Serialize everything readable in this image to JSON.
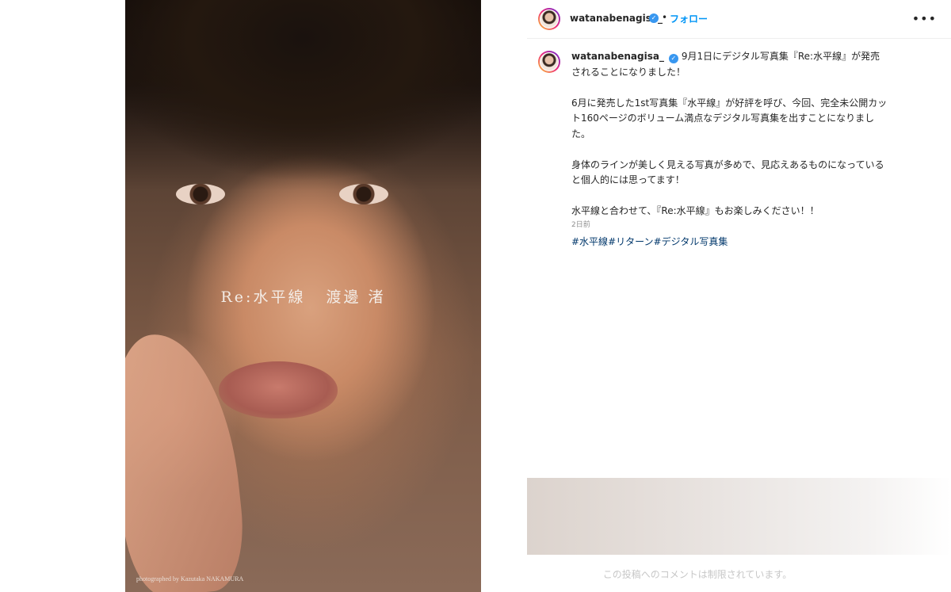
{
  "post": {
    "cover_title_main": "Re:水平線",
    "cover_title_name": "渡邊 渚",
    "cover_credit": "photographed by Kazutaka NAKAMURA"
  },
  "header": {
    "username": "watanabenagisa_",
    "separator": "•",
    "follow_label": "フォロー",
    "more_icon": "more-horizontal-icon"
  },
  "caption": {
    "username": "watanabenagisa_",
    "lead": "9月1日にデジタル写真集『Re:水平線』が発売されることになりました！",
    "paragraphs": [
      "6月に発売した1st写真集『水平線』が好評を呼び、今回、完全未公開カット160ページのボリューム満点なデジタル写真集を出すことになりました。",
      "身体のラインが美しく見える写真が多めで、見応えあるものになっていると個人的には思ってます！",
      "水平線と合わせて、『Re:水平線』もお楽しみください！！"
    ],
    "hashtags": [
      "#水平線",
      "#リターン",
      "#デジタル写真集"
    ],
    "timestamp": "2日前"
  },
  "comments": {
    "disabled_text": "この投稿へのコメントは制限されています。"
  },
  "colors": {
    "link_blue": "#0095f6",
    "hashtag": "#00376b",
    "text": "#262626",
    "muted": "#8e8e8e",
    "verified": "#3897f0"
  }
}
